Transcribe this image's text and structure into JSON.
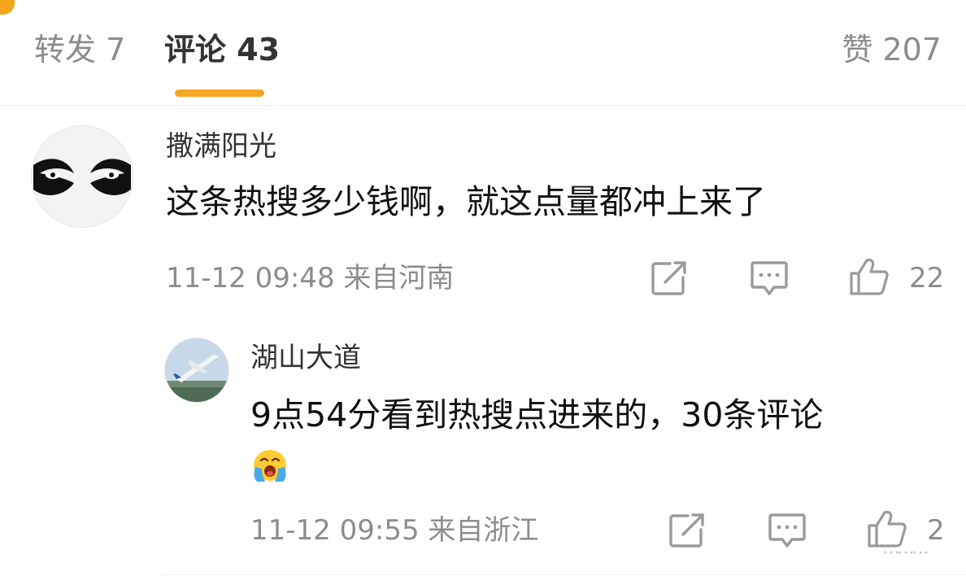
{
  "tabs": {
    "repost": "转发 7",
    "comments": "评论 43",
    "likes": "赞 207"
  },
  "comments": [
    {
      "user": "撒满阳光",
      "text": "这条热搜多少钱啊，就这点量都冲上来了",
      "meta": "11-12 09:48 来自河南",
      "like_count": "22",
      "icons": [
        "share-icon",
        "reply-icon",
        "thumbs-up-icon"
      ]
    },
    {
      "user": "湖山大道",
      "text": "9点54分看到热搜点进来的，30条评论",
      "emoji": "crying-face-emoji",
      "meta": "11-12 09:55 来自浙江",
      "like_count": "2",
      "icons": [
        "share-icon",
        "reply-icon",
        "thumbs-up-icon"
      ]
    }
  ],
  "watermark": "⋯⋯⋯",
  "colors": {
    "accent": "#f5a623",
    "muted_text": "#8c8c8c",
    "primary_text": "#111111"
  }
}
